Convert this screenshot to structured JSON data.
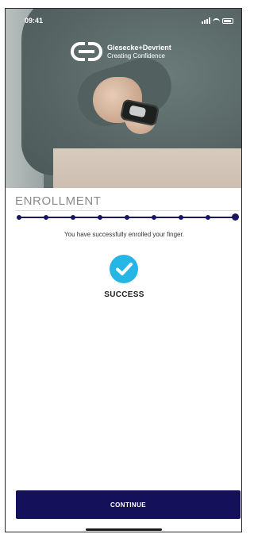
{
  "status_bar": {
    "time": "09:41"
  },
  "brand": {
    "name": "Giesecke+Devrient",
    "tagline": "Creating Confidence"
  },
  "enrollment": {
    "title": "ENROLLMENT",
    "steps_total": 9,
    "steps_completed": 9,
    "message": "You have successfully enrolled your finger.",
    "status": "SUCCESS"
  },
  "continue_label": "CONTINUE",
  "colors": {
    "primary": "#15105a",
    "success": "#25b6e6",
    "title": "#8a8a8a"
  },
  "icons": {
    "success": "check-circle-icon",
    "logo": "gd-logo-icon"
  }
}
